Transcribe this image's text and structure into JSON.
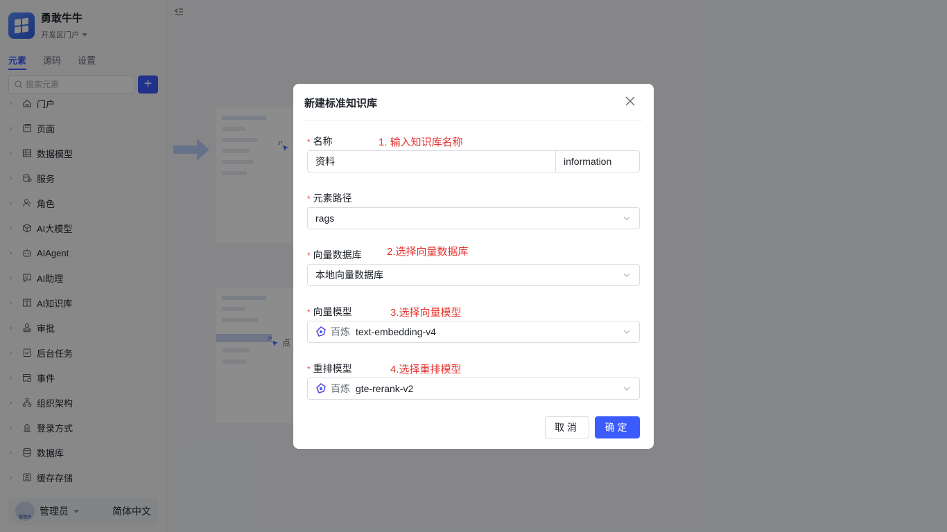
{
  "app": {
    "name": "勇敢牛牛",
    "workspace": "开发区门户"
  },
  "tabs": [
    {
      "label": "元素",
      "active": true
    },
    {
      "label": "源码",
      "active": false
    },
    {
      "label": "设置",
      "active": false
    }
  ],
  "search": {
    "placeholder": "搜索元素",
    "add_label": "+"
  },
  "tree": [
    {
      "label": "门户",
      "icon": "home-icon"
    },
    {
      "label": "页面",
      "icon": "page-icon"
    },
    {
      "label": "数据模型",
      "icon": "table-icon"
    },
    {
      "label": "服务",
      "icon": "service-icon"
    },
    {
      "label": "角色",
      "icon": "role-icon"
    },
    {
      "label": "AI大模型",
      "icon": "cube-icon"
    },
    {
      "label": "AIAgent",
      "icon": "robot-icon"
    },
    {
      "label": "AI助理",
      "icon": "ai-assistant-icon"
    },
    {
      "label": "AI知识库",
      "icon": "book-icon"
    },
    {
      "label": "审批",
      "icon": "stamp-icon"
    },
    {
      "label": "后台任务",
      "icon": "task-icon"
    },
    {
      "label": "事件",
      "icon": "event-icon"
    },
    {
      "label": "组织架构",
      "icon": "org-icon"
    },
    {
      "label": "登录方式",
      "icon": "login-icon"
    },
    {
      "label": "数据库",
      "icon": "database-icon"
    },
    {
      "label": "缓存存储",
      "icon": "cache-icon"
    }
  ],
  "footer": {
    "avatar_text": "管理员",
    "user": "管理员",
    "language": "简体中文"
  },
  "workspace_text": [
    "点"
  ],
  "modal": {
    "title": "新建标准知识库",
    "fields": {
      "name": {
        "label": "名称",
        "value": "资料",
        "suffix": "information",
        "annotation": "1. 输入知识库名称"
      },
      "path": {
        "label": "元素路径",
        "value": "rags"
      },
      "vector_db": {
        "label": "向量数据库",
        "value": "本地向量数据库",
        "annotation": "2.选择向量数据库"
      },
      "vector_model": {
        "label": "向量模型",
        "provider": "百炼",
        "value": "text-embedding-v4",
        "annotation": "3.选择向量模型"
      },
      "rerank_model": {
        "label": "重排模型",
        "provider": "百炼",
        "value": "gte-rerank-v2",
        "annotation": "4.选择重排模型"
      }
    },
    "cancel_label": "取消",
    "ok_label": "确定"
  },
  "colors": {
    "primary": "#3b5bfd",
    "required": "#f54a45",
    "annotation": "#e5322d"
  }
}
